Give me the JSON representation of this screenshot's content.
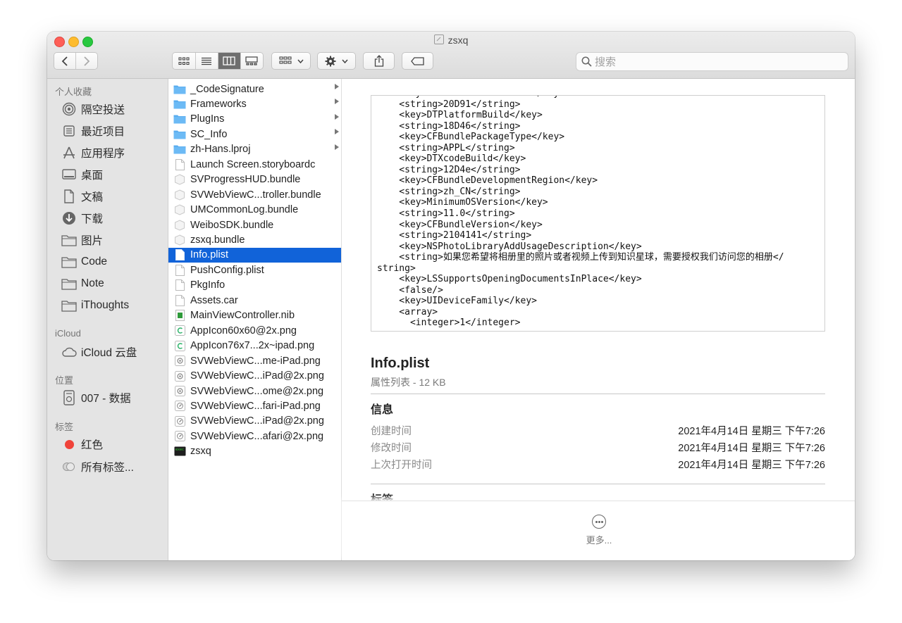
{
  "window": {
    "title": "zsxq"
  },
  "toolbar": {
    "search_placeholder": "搜索"
  },
  "sidebar": {
    "favorites_header": "个人收藏",
    "favorites": [
      {
        "label": "隔空投送",
        "icon": "airdrop-icon"
      },
      {
        "label": "最近项目",
        "icon": "recents-icon"
      },
      {
        "label": "应用程序",
        "icon": "applications-icon"
      },
      {
        "label": "桌面",
        "icon": "desktop-icon"
      },
      {
        "label": "文稿",
        "icon": "documents-icon"
      },
      {
        "label": "下载",
        "icon": "downloads-icon"
      },
      {
        "label": "图片",
        "icon": "folder-icon"
      },
      {
        "label": "Code",
        "icon": "folder-icon"
      },
      {
        "label": "Note",
        "icon": "folder-icon"
      },
      {
        "label": "iThoughts",
        "icon": "folder-icon"
      }
    ],
    "icloud_header": "iCloud",
    "icloud": [
      {
        "label": "iCloud 云盘",
        "icon": "cloud-icon"
      }
    ],
    "locations_header": "位置",
    "locations": [
      {
        "label": "007 - 数据",
        "icon": "disk-icon"
      }
    ],
    "tags_header": "标签",
    "tags": [
      {
        "label": "红色",
        "color": "#f0433a"
      },
      {
        "label": "所有标签...",
        "color": "#cccccc"
      }
    ]
  },
  "files": [
    {
      "name": "_CodeSignature",
      "type": "folder",
      "has_children": true
    },
    {
      "name": "Frameworks",
      "type": "folder",
      "has_children": true
    },
    {
      "name": "PlugIns",
      "type": "folder",
      "has_children": true
    },
    {
      "name": "SC_Info",
      "type": "folder",
      "has_children": true
    },
    {
      "name": "zh-Hans.lproj",
      "type": "folder",
      "has_children": true
    },
    {
      "name": "Launch Screen.storyboardc",
      "type": "file"
    },
    {
      "name": "SVProgressHUD.bundle",
      "type": "bundle"
    },
    {
      "name": "SVWebViewC...troller.bundle",
      "type": "bundle"
    },
    {
      "name": "UMCommonLog.bundle",
      "type": "bundle"
    },
    {
      "name": "WeiboSDK.bundle",
      "type": "bundle"
    },
    {
      "name": "zsxq.bundle",
      "type": "bundle"
    },
    {
      "name": "Info.plist",
      "type": "file",
      "selected": true
    },
    {
      "name": "PushConfig.plist",
      "type": "file"
    },
    {
      "name": "PkgInfo",
      "type": "file"
    },
    {
      "name": "Assets.car",
      "type": "file"
    },
    {
      "name": "MainViewController.nib",
      "type": "nib"
    },
    {
      "name": "AppIcon60x60@2x.png",
      "type": "appicon"
    },
    {
      "name": "AppIcon76x7...2x~ipad.png",
      "type": "appicon"
    },
    {
      "name": "SVWebViewC...me-iPad.png",
      "type": "image"
    },
    {
      "name": "SVWebViewC...iPad@2x.png",
      "type": "image"
    },
    {
      "name": "SVWebViewC...ome@2x.png",
      "type": "image"
    },
    {
      "name": "SVWebViewC...fari-iPad.png",
      "type": "compass"
    },
    {
      "name": "SVWebViewC...iPad@2x.png",
      "type": "compass"
    },
    {
      "name": "SVWebViewC...afari@2x.png",
      "type": "compass"
    },
    {
      "name": "zsxq",
      "type": "exec"
    }
  ],
  "preview": {
    "code_lines": [
      "    <key>BuildMachineOSBuild</key>",
      "    <string>20D91</string>",
      "    <key>DTPlatformBuild</key>",
      "    <string>18D46</string>",
      "    <key>CFBundlePackageType</key>",
      "    <string>APPL</string>",
      "    <key>DTXcodeBuild</key>",
      "    <string>12D4e</string>",
      "    <key>CFBundleDevelopmentRegion</key>",
      "    <string>zh_CN</string>",
      "    <key>MinimumOSVersion</key>",
      "    <string>11.0</string>",
      "    <key>CFBundleVersion</key>",
      "    <string>2104141</string>",
      "    <key>NSPhotoLibraryAddUsageDescription</key>",
      "    <string>如果您希望将相册里的照片或者视频上传到知识星球，需要授权我们访问您的相册</",
      "string>",
      "    <key>LSSupportsOpeningDocumentsInPlace</key>",
      "    <false/>",
      "    <key>UIDeviceFamily</key>",
      "    <array>",
      "      <integer>1</integer>"
    ],
    "file_name": "Info.plist",
    "file_subtitle": "属性列表 - 12 KB",
    "info_title": "信息",
    "info_rows": [
      {
        "key": "创建时间",
        "value": "2021年4月14日 星期三 下午7:26"
      },
      {
        "key": "修改时间",
        "value": "2021年4月14日 星期三 下午7:26"
      },
      {
        "key": "上次打开时间",
        "value": "2021年4月14日 星期三 下午7:26"
      }
    ],
    "tags_title": "标签",
    "more_label": "更多..."
  }
}
